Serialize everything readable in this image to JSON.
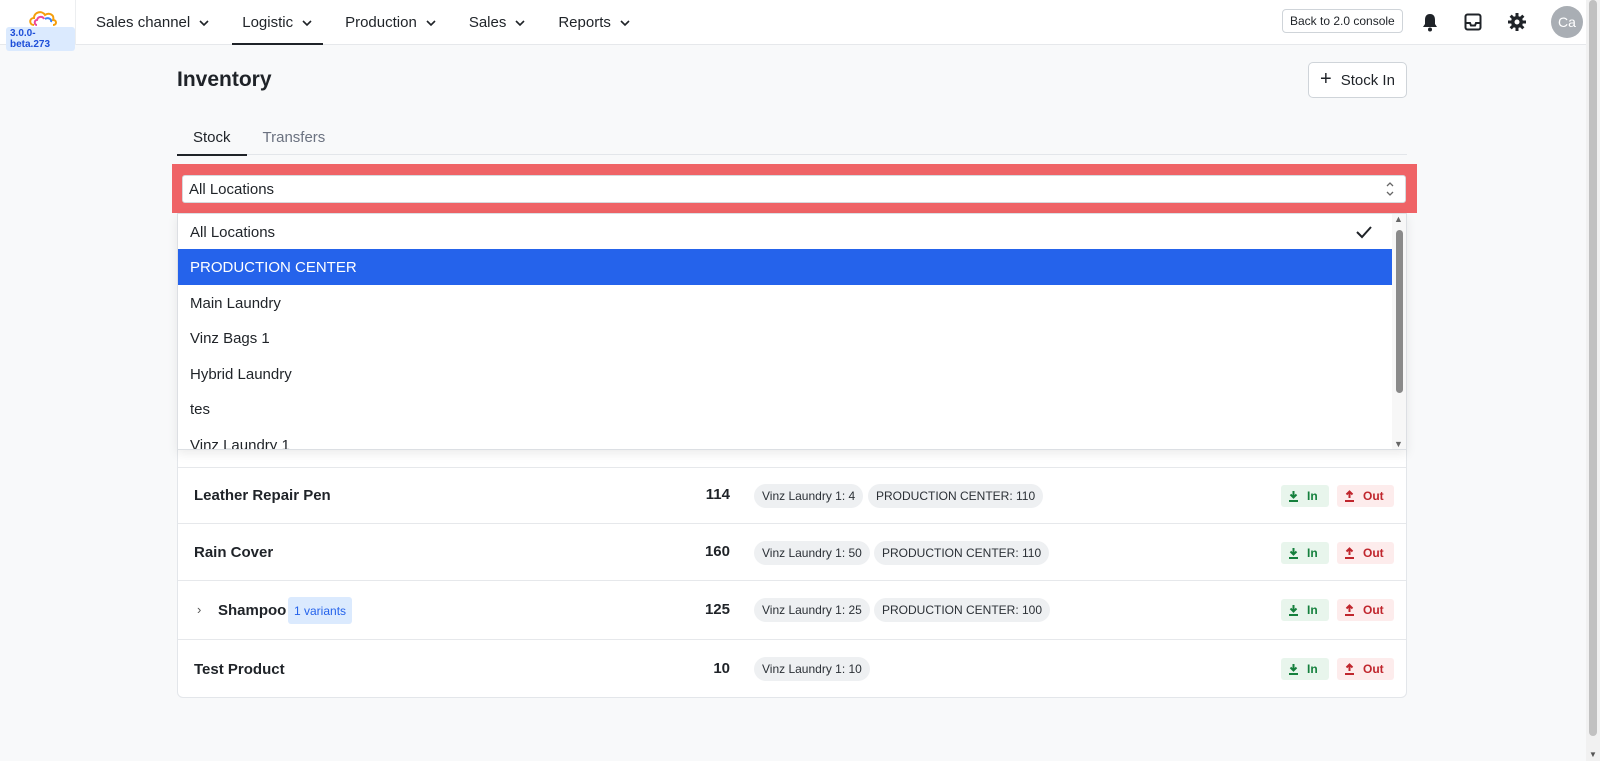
{
  "app": {
    "version": "3.0.0-beta.273",
    "back_button": "Back to 2.0 console",
    "avatar_initials": "Ca"
  },
  "nav": [
    {
      "label": "Sales channel",
      "active": false
    },
    {
      "label": "Logistic",
      "active": true
    },
    {
      "label": "Production",
      "active": false
    },
    {
      "label": "Sales",
      "active": false
    },
    {
      "label": "Reports",
      "active": false
    }
  ],
  "page": {
    "title": "Inventory",
    "stock_in_label": "Stock In",
    "tabs": [
      "Stock",
      "Transfers"
    ]
  },
  "location_select": {
    "value": "All Locations",
    "options": [
      {
        "label": "All Locations",
        "selected": true,
        "highlighted": false
      },
      {
        "label": "PRODUCTION CENTER",
        "selected": false,
        "highlighted": true
      },
      {
        "label": "Main Laundry",
        "selected": false,
        "highlighted": false
      },
      {
        "label": "Vinz Bags 1",
        "selected": false,
        "highlighted": false
      },
      {
        "label": "Hybrid Laundry",
        "selected": false,
        "highlighted": false
      },
      {
        "label": "tes",
        "selected": false,
        "highlighted": false
      },
      {
        "label": "Vinz Laundry 1",
        "selected": false,
        "highlighted": false
      }
    ]
  },
  "products": [
    {
      "name": "Leather Repair Pen",
      "qty": "114",
      "locations": [
        "Vinz Laundry 1: 4",
        "PRODUCTION CENTER: 110"
      ]
    },
    {
      "name": "Rain Cover",
      "qty": "160",
      "locations": [
        "Vinz Laundry 1: 50",
        "PRODUCTION CENTER: 110"
      ]
    },
    {
      "name": "Shampoo",
      "qty": "125",
      "variants": "1 variants",
      "locations": [
        "Vinz Laundry 1: 25",
        "PRODUCTION CENTER: 100"
      ]
    },
    {
      "name": "Test Product",
      "qty": "10",
      "locations": [
        "Vinz Laundry 1: 10"
      ]
    }
  ],
  "row_actions": {
    "in_label": "In",
    "out_label": "Out"
  },
  "colors": {
    "accent": "#2563eb",
    "highlight_frame": "#ef6366",
    "in_green": "#15803d",
    "out_red": "#c0262d"
  }
}
